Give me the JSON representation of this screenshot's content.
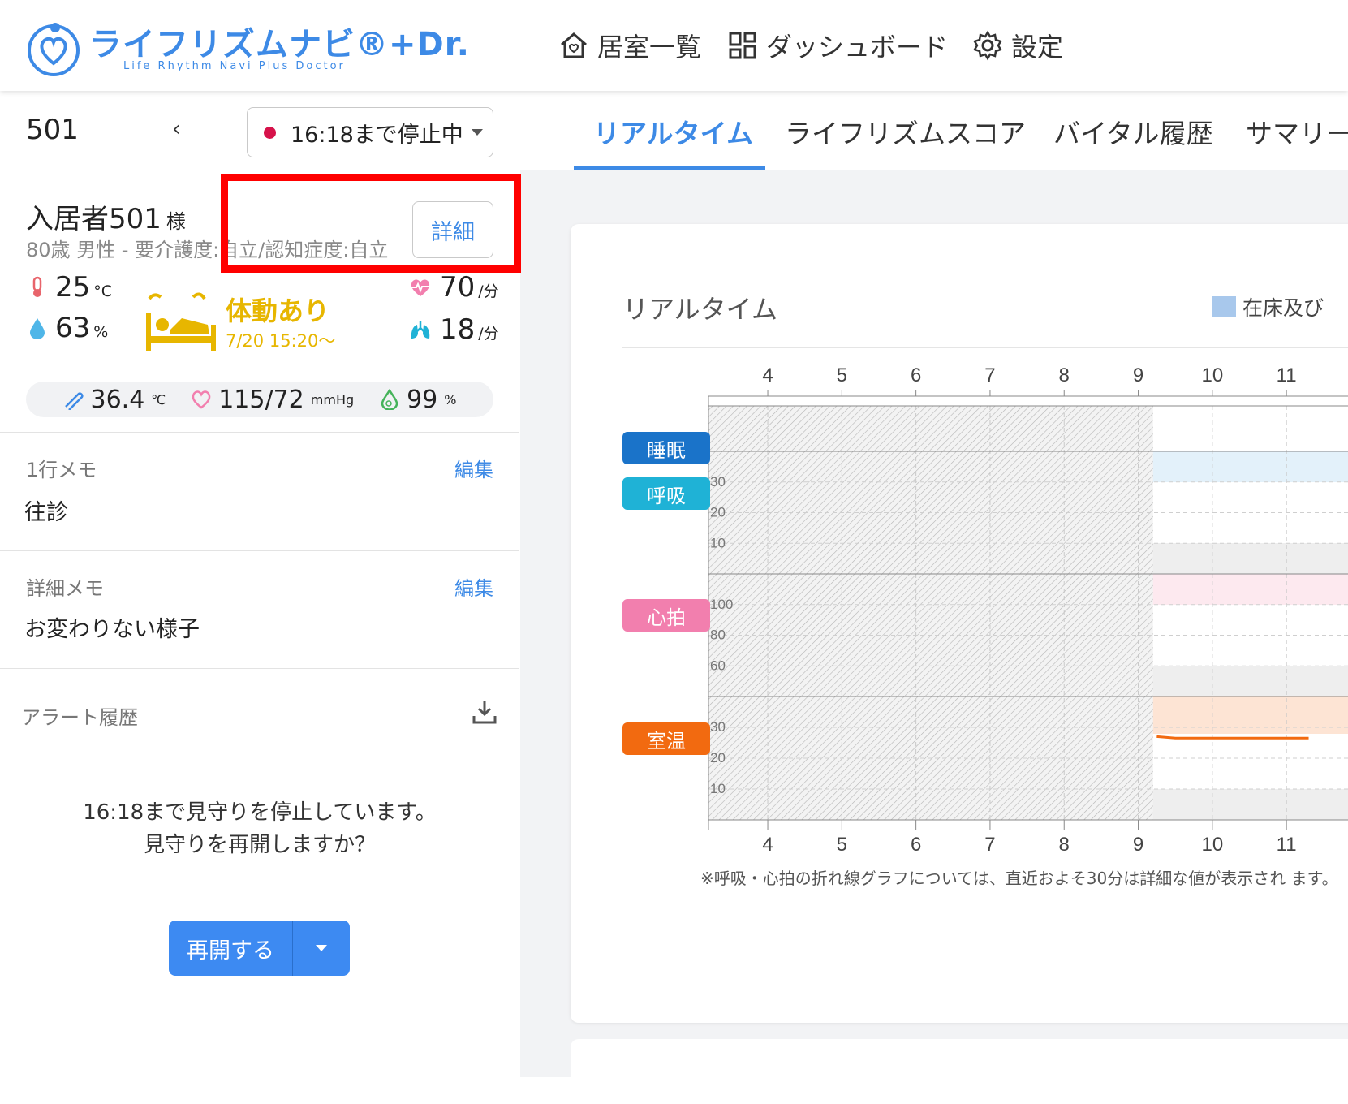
{
  "header": {
    "logo_text": "ライフリズムナビ®+Dr.",
    "logo_sub": "Life Rhythm Navi  Plus Doctor",
    "nav": [
      {
        "label": "居室一覧",
        "icon": "home-icon"
      },
      {
        "label": "ダッシュボード",
        "icon": "dashboard-grid-icon"
      },
      {
        "label": "設定",
        "icon": "gear-icon"
      }
    ]
  },
  "room": {
    "number": "501",
    "prev_label": "‹",
    "status_label": "16:18まで停止中"
  },
  "resident": {
    "name": "入居者501",
    "honorific": "様",
    "info": "80歳 男性 - 要介護度:自立/認知症度:自立",
    "detail_button": "詳細"
  },
  "environment": {
    "temperature": "25",
    "temperature_unit": "°C",
    "humidity": "63",
    "humidity_unit": "%"
  },
  "activity": {
    "status": "体動あり",
    "since": "7/20 15:20〜"
  },
  "vitals_right": {
    "heart_rate": "70",
    "heart_rate_unit": "/分",
    "respiration": "18",
    "respiration_unit": "/分"
  },
  "vitals_pill": {
    "body_temp": "36.4",
    "body_temp_unit": "℃",
    "blood_pressure": "115/72",
    "bp_unit": "mmHg",
    "spo2": "99",
    "spo2_unit": "%"
  },
  "memo_short": {
    "label": "1行メモ",
    "edit": "編集",
    "value": "往診"
  },
  "memo_detail": {
    "label": "詳細メモ",
    "edit": "編集",
    "value": "お変わりない様子"
  },
  "alerts": {
    "label": "アラート履歴",
    "pause_line1": "16:18まで見守りを停止しています。",
    "pause_line2": "見守りを再開しますか？",
    "resume_button": "再開する"
  },
  "tabs": [
    {
      "label": "リアルタイム",
      "active": true
    },
    {
      "label": "ライフリズムスコア",
      "active": false
    },
    {
      "label": "バイタル履歴",
      "active": false
    },
    {
      "label": "サマリー",
      "active": false
    }
  ],
  "realtime": {
    "title": "リアルタイム",
    "legend_label": "在床及び",
    "rows": [
      {
        "label": "睡眠",
        "color": "#1a73c9"
      },
      {
        "label": "呼吸",
        "color": "#1fb2d6"
      },
      {
        "label": "心拍",
        "color": "#f27fae"
      },
      {
        "label": "室温",
        "color": "#f26a10"
      }
    ],
    "note": "※呼吸・心拍の折れ線グラフについては、直近およそ30分は詳細な値が表示され ます。"
  },
  "chart_data": {
    "type": "line",
    "x_ticks": [
      "4",
      "5",
      "6",
      "7",
      "8",
      "9",
      "10",
      "11"
    ],
    "panels": [
      {
        "name": "睡眠",
        "y_ticks": []
      },
      {
        "name": "呼吸",
        "y_ticks": [
          "30",
          "20",
          "10"
        ]
      },
      {
        "name": "心拍",
        "y_ticks": [
          "100",
          "80",
          "60"
        ]
      },
      {
        "name": "室温",
        "y_ticks": [
          "30",
          "20",
          "10"
        ],
        "series": [
          {
            "name": "室温",
            "color": "#f26a10",
            "x": [
              9.25,
              9.5,
              10,
              10.5,
              11,
              11.3
            ],
            "values": [
              27,
              26.5,
              26.5,
              26.5,
              26.5,
              26.5
            ]
          }
        ]
      }
    ],
    "hatched_until_x": 9.2
  }
}
